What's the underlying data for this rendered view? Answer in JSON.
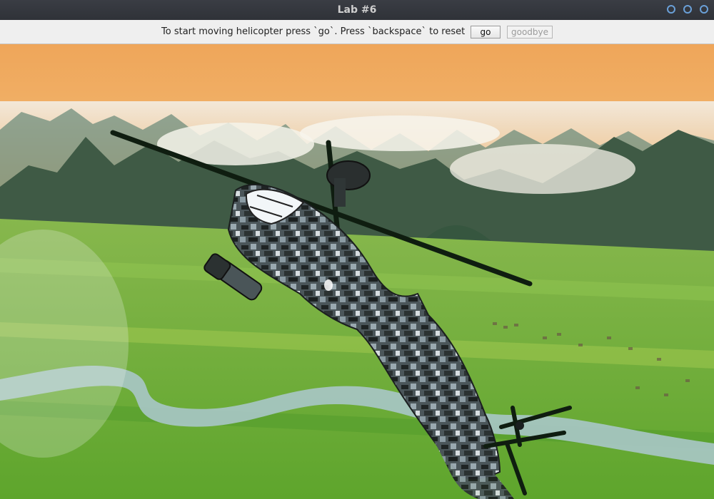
{
  "window": {
    "title": "Lab #6",
    "controls": [
      "circle-button",
      "circle-button",
      "circle-button"
    ]
  },
  "toolbar": {
    "instructions": "To start moving helicopter press `go`. Press `backspace` to reset",
    "go_label": "go",
    "goodbye_label": "goodbye",
    "goodbye_enabled": false
  },
  "scene": {
    "subject": "3D camouflage helicopter",
    "background": "mountain valley with rice fields and river",
    "colors": {
      "sky_top": "#f0b15f",
      "sky_bottom": "#f4d59b",
      "mountain": "#4f6a52",
      "fields": "#6fb33a",
      "river": "#a9c6c8",
      "heli_dark": "#2a3131",
      "heli_light": "#8f9fa7",
      "rotor": "#102012"
    }
  }
}
